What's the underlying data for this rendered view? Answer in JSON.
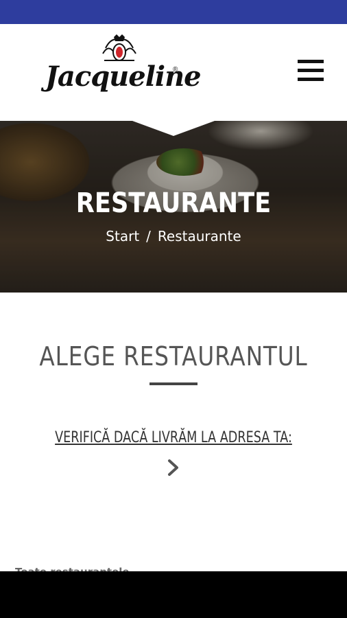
{
  "header": {
    "logo_text": "Jacqueline",
    "logo_reg": "®",
    "menu_icon": "hamburger-icon"
  },
  "hero": {
    "title": "RESTAURANTE",
    "breadcrumb": {
      "start": "Start",
      "separator": "/",
      "current": "Restaurante"
    }
  },
  "main": {
    "section_title": "ALEGE RESTAURANTUL",
    "delivery_link": "VERIFICĂ DACĂ LIVRĂM LA ADRESA TA:",
    "chevron_icon": "chevron-right-icon",
    "all_restaurants_label": "Toate restaurantele"
  },
  "colors": {
    "status_bar": "#2e3d9e",
    "text_dark": "#555555",
    "nav_bar": "#000000"
  }
}
